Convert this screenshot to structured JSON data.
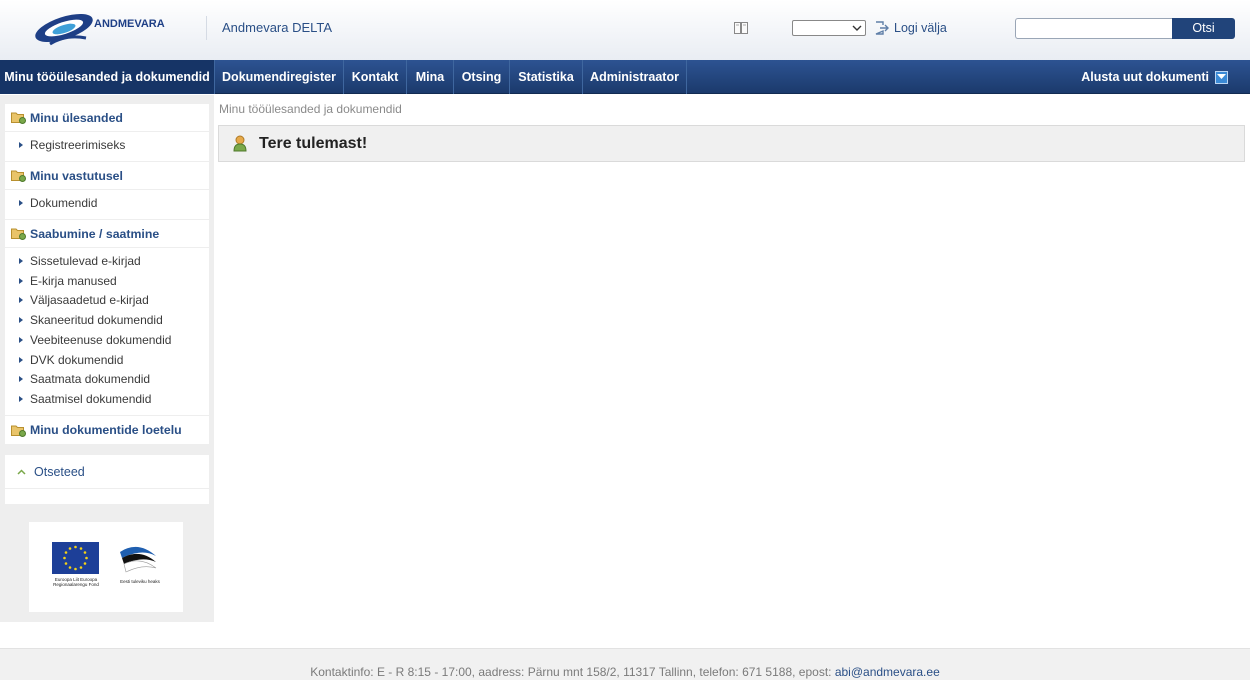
{
  "header": {
    "logo_text": "ANDMEVARA",
    "app_title": "Andmevara DELTA",
    "language_value": "",
    "logout_label": "Logi välja",
    "search_value": "",
    "search_button": "Otsi"
  },
  "nav": {
    "items": [
      {
        "label": "Minu tööülesanded ja dokumendid",
        "active": true
      },
      {
        "label": "Dokumendiregister"
      },
      {
        "label": "Kontakt"
      },
      {
        "label": "Mina"
      },
      {
        "label": "Otsing"
      },
      {
        "label": "Statistika"
      },
      {
        "label": "Administraator"
      }
    ],
    "new_document": "Alusta uut dokumenti"
  },
  "sidebar": {
    "groups": [
      {
        "title": "Minu ülesanded",
        "items": [
          "Registreerimiseks"
        ]
      },
      {
        "title": "Minu vastutusel",
        "items": [
          "Dokumendid"
        ]
      },
      {
        "title": "Saabumine / saatmine",
        "items": [
          "Sissetulevad e-kirjad",
          "E-kirja manused",
          "Väljasaadetud e-kirjad",
          "Skaneeritud dokumendid",
          "Veebiteenuse dokumendid",
          "DVK dokumendid",
          "Saatmata dokumendid",
          "Saatmisel dokumendid"
        ]
      },
      {
        "title": "Minu dokumentide loetelu",
        "items": []
      }
    ],
    "shortcuts_label": "Otseteed"
  },
  "funding": {
    "eu_text": "Euroopa Liit Euroopa Regionaalarengu Fond",
    "ee_text": "Eesti tuleviku heaks"
  },
  "main": {
    "breadcrumb": "Minu tööülesanded ja dokumendid",
    "welcome": "Tere tulemast!"
  },
  "footer": {
    "contact_text": "Kontaktinfo: E - R 8:15 - 17:00, aadress: Pärnu mnt 158/2, 11317 Tallinn, telefon: 671 5188, epost: ",
    "email": "abi@andmevara.ee"
  },
  "colors": {
    "nav_bg": "#1f4278",
    "brand_blue": "#2a4f86",
    "accent_green": "#7aa84a"
  }
}
